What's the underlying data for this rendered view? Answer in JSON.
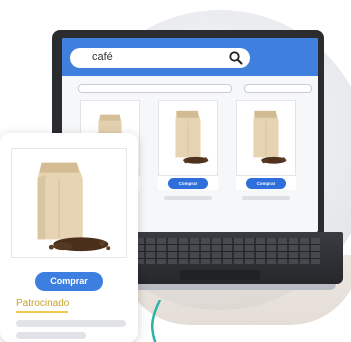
{
  "search": {
    "value": "café",
    "icon": "search-icon"
  },
  "listing": {
    "buy_label": "Comprar",
    "products": [
      {
        "name": "coffee-bag"
      },
      {
        "name": "coffee-bag"
      },
      {
        "name": "coffee-bag"
      }
    ]
  },
  "featured": {
    "buy_label": "Comprar",
    "sponsored_label": "Patrocinado"
  },
  "colors": {
    "primary": "#3d7fe0",
    "sponsored": "#c9a227",
    "highlight": "#f2c94c"
  }
}
